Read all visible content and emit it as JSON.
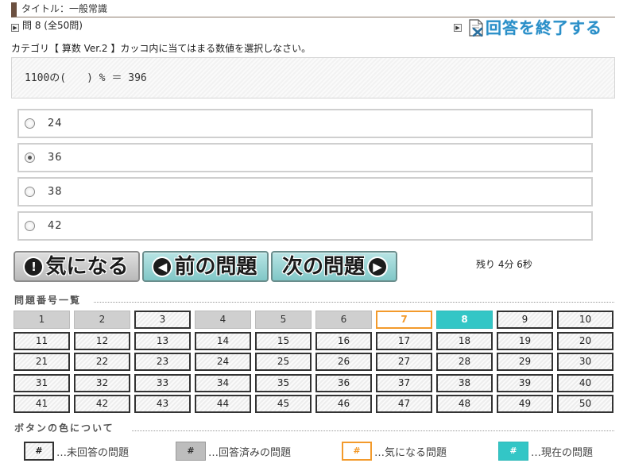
{
  "header": {
    "title": "タイトル：一般常識"
  },
  "question": {
    "number_label": "問 8 (全50問)",
    "category_instruction": "カテゴリ【 算数 Ver.2 】カッコ内に当てはまる数値を選択しなさい。",
    "text": "1100の(　　) % ＝ 396",
    "options": [
      {
        "label": "24",
        "selected": false
      },
      {
        "label": "36",
        "selected": true
      },
      {
        "label": "38",
        "selected": false
      },
      {
        "label": "42",
        "selected": false
      }
    ]
  },
  "end_button": {
    "label": "回答を終了する"
  },
  "nav": {
    "flag_label": "気になる",
    "prev_label": "前の問題",
    "next_label": "次の問題",
    "timer": "残り 4分 6秒"
  },
  "question_list": {
    "heading": "問題番号一覧",
    "items": [
      {
        "n": "1",
        "state": "answered"
      },
      {
        "n": "2",
        "state": "answered"
      },
      {
        "n": "3",
        "state": "unanswered"
      },
      {
        "n": "4",
        "state": "answered"
      },
      {
        "n": "5",
        "state": "answered"
      },
      {
        "n": "6",
        "state": "answered"
      },
      {
        "n": "7",
        "state": "flagged"
      },
      {
        "n": "8",
        "state": "current"
      },
      {
        "n": "9",
        "state": "unanswered"
      },
      {
        "n": "10",
        "state": "unanswered"
      },
      {
        "n": "11",
        "state": "unanswered"
      },
      {
        "n": "12",
        "state": "unanswered"
      },
      {
        "n": "13",
        "state": "unanswered"
      },
      {
        "n": "14",
        "state": "unanswered"
      },
      {
        "n": "15",
        "state": "unanswered"
      },
      {
        "n": "16",
        "state": "unanswered"
      },
      {
        "n": "17",
        "state": "unanswered"
      },
      {
        "n": "18",
        "state": "unanswered"
      },
      {
        "n": "19",
        "state": "unanswered"
      },
      {
        "n": "20",
        "state": "unanswered"
      },
      {
        "n": "21",
        "state": "unanswered"
      },
      {
        "n": "22",
        "state": "unanswered"
      },
      {
        "n": "23",
        "state": "unanswered"
      },
      {
        "n": "24",
        "state": "unanswered"
      },
      {
        "n": "25",
        "state": "unanswered"
      },
      {
        "n": "26",
        "state": "unanswered"
      },
      {
        "n": "27",
        "state": "unanswered"
      },
      {
        "n": "28",
        "state": "unanswered"
      },
      {
        "n": "29",
        "state": "unanswered"
      },
      {
        "n": "30",
        "state": "unanswered"
      },
      {
        "n": "31",
        "state": "unanswered"
      },
      {
        "n": "32",
        "state": "unanswered"
      },
      {
        "n": "33",
        "state": "unanswered"
      },
      {
        "n": "34",
        "state": "unanswered"
      },
      {
        "n": "35",
        "state": "unanswered"
      },
      {
        "n": "36",
        "state": "unanswered"
      },
      {
        "n": "37",
        "state": "unanswered"
      },
      {
        "n": "38",
        "state": "unanswered"
      },
      {
        "n": "39",
        "state": "unanswered"
      },
      {
        "n": "40",
        "state": "unanswered"
      },
      {
        "n": "41",
        "state": "unanswered"
      },
      {
        "n": "42",
        "state": "unanswered"
      },
      {
        "n": "43",
        "state": "unanswered"
      },
      {
        "n": "44",
        "state": "unanswered"
      },
      {
        "n": "45",
        "state": "unanswered"
      },
      {
        "n": "46",
        "state": "unanswered"
      },
      {
        "n": "47",
        "state": "unanswered"
      },
      {
        "n": "48",
        "state": "unanswered"
      },
      {
        "n": "49",
        "state": "unanswered"
      },
      {
        "n": "50",
        "state": "unanswered"
      }
    ]
  },
  "legend": {
    "heading": "ボタンの色について",
    "swatch_symbol": "#",
    "unanswered": "…未回答の問題",
    "answered": "…回答済みの問題",
    "flagged": "…気になる問題",
    "current": "…現在の問題"
  },
  "colors": {
    "accent_teal": "#33c6c6",
    "flag_orange": "#f39a2b",
    "end_link_blue": "#2a8fc8",
    "title_bar_brown": "#6b5040"
  }
}
